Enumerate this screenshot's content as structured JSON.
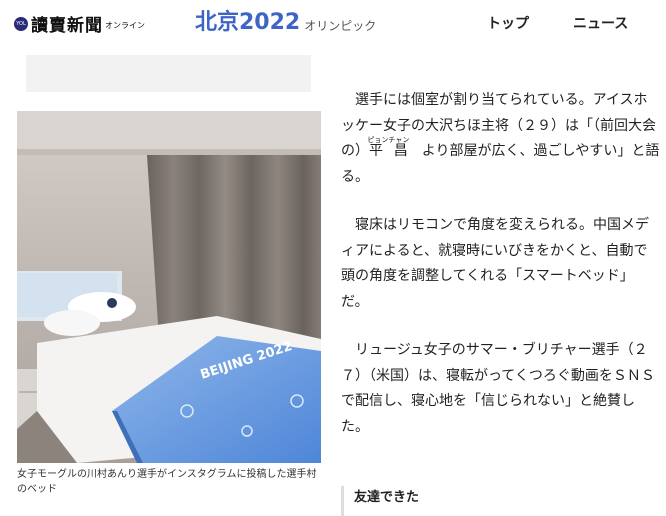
{
  "header": {
    "logo_mark": "YOL",
    "logo_name": "讀賣新聞",
    "logo_sub": "オンライン",
    "brand_main": "北京2022",
    "brand_sub": "オリンピック",
    "nav": [
      {
        "label": "トップ"
      },
      {
        "label": "ニュース"
      }
    ]
  },
  "photo": {
    "caption": "女子モーグルの川村あんり選手がインスタグラムに投稿した選手村のベッド",
    "blanket_text": "BEIJING 2022"
  },
  "article": {
    "p1_a": "選手には個室が割り当てられている。アイスホッケー女子の大沢ちほ主将（２９）は「（前回大会の）",
    "p1_ruby_base": "平 昌",
    "p1_ruby_text": "ピョンチャン",
    "p1_b": "より部屋が広く、過ごしやすい」と語る。",
    "p2": "寝床はリモコンで角度を変えられる。中国メディアによると、就寝時にいびきをかくと、自動で頭の角度を調整してくれる「スマートベッド」だ。",
    "p3": "リュージュ女子のサマー・ブリチャー選手（２７）（米国）は、寝転がってくつろぐ動画をＳＮＳで配信し、寝心地を「信じられない」と絶賛した。"
  },
  "related": {
    "heading": "友達できた"
  },
  "colors": {
    "brand_blue": "#3d64c6",
    "blanket_blue": "#4e86d8"
  }
}
